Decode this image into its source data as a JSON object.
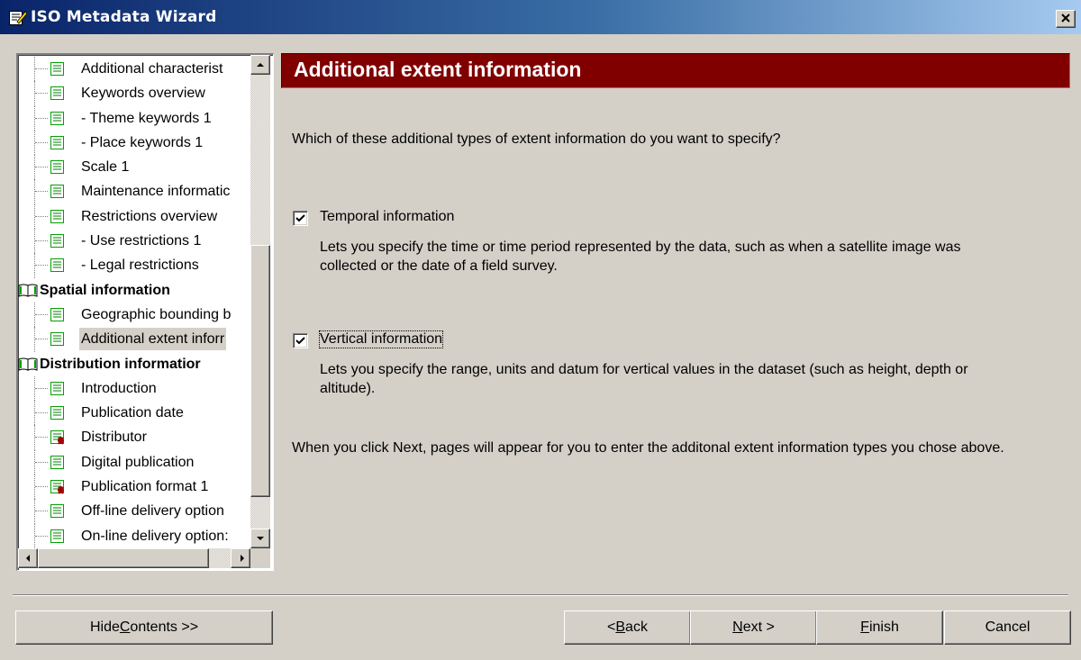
{
  "window": {
    "title": "ISO Metadata Wizard",
    "close_glyph": "×"
  },
  "tree": {
    "items": [
      {
        "label": "Additional characterist",
        "type": "page",
        "icon": "page-icon"
      },
      {
        "label": "Keywords overview",
        "type": "page",
        "icon": "page-icon"
      },
      {
        "label": "- Theme keywords 1",
        "type": "page",
        "icon": "page-icon"
      },
      {
        "label": "- Place keywords 1",
        "type": "page",
        "icon": "page-icon"
      },
      {
        "label": "Scale 1",
        "type": "page",
        "icon": "page-icon"
      },
      {
        "label": "Maintenance informatic",
        "type": "page",
        "icon": "page-icon"
      },
      {
        "label": "Restrictions overview",
        "type": "page",
        "icon": "page-icon"
      },
      {
        "label": "- Use restrictions 1",
        "type": "page",
        "icon": "page-icon"
      },
      {
        "label": "- Legal restrictions",
        "type": "page",
        "icon": "page-icon"
      },
      {
        "label": "Spatial information",
        "type": "section",
        "icon": "book-icon"
      },
      {
        "label": "Geographic bounding b",
        "type": "page",
        "icon": "page-icon"
      },
      {
        "label": "Additional extent inforr",
        "type": "page",
        "icon": "page-icon",
        "selected": true
      },
      {
        "label": "Distribution informatior",
        "type": "section",
        "icon": "book-icon"
      },
      {
        "label": "Introduction",
        "type": "page",
        "icon": "page-icon"
      },
      {
        "label": "Publication date",
        "type": "page",
        "icon": "page-icon"
      },
      {
        "label": "Distributor",
        "type": "page",
        "icon": "required-page-icon"
      },
      {
        "label": "Digital publication",
        "type": "page",
        "icon": "page-icon"
      },
      {
        "label": "Publication format 1",
        "type": "page",
        "icon": "required-page-icon"
      },
      {
        "label": "Off-line delivery option",
        "type": "page",
        "icon": "page-icon"
      },
      {
        "label": "On-line delivery option:",
        "type": "page",
        "icon": "page-icon"
      }
    ],
    "scroll_position": 0.55
  },
  "page": {
    "heading": "Additional extent information",
    "question": "Which of these additional types of extent information do you want to specify?",
    "options": [
      {
        "label": "Temporal information",
        "checked": true,
        "description": "Lets you specify the time or time period represented by the data, such as when a satellite image was collected or the date of a field survey."
      },
      {
        "label": "Vertical information",
        "checked": true,
        "description": "Lets you specify the range, units and datum for vertical values in the dataset (such as height, depth or altitude)."
      }
    ],
    "footnote": "When you click Next, pages will appear for you to enter the additonal extent information types you chose above."
  },
  "buttons": {
    "hide_contents": {
      "pre": "Hide ",
      "ul": "C",
      "post": "ontents >>"
    },
    "back": {
      "pre": "< ",
      "ul": "B",
      "post": "ack"
    },
    "next": {
      "pre": "",
      "ul": "N",
      "post": "ext >"
    },
    "finish": {
      "pre": "",
      "ul": "F",
      "post": "inish"
    },
    "cancel": {
      "pre": "Cancel",
      "ul": "",
      "post": ""
    }
  },
  "colors": {
    "header_bg": "#800000",
    "titlebar_start": "#0a246a",
    "titlebar_end": "#a6caf0",
    "dialog_bg": "#d4d0c8",
    "page_icon_green": "#00a000",
    "required_marker": "#a00000"
  }
}
